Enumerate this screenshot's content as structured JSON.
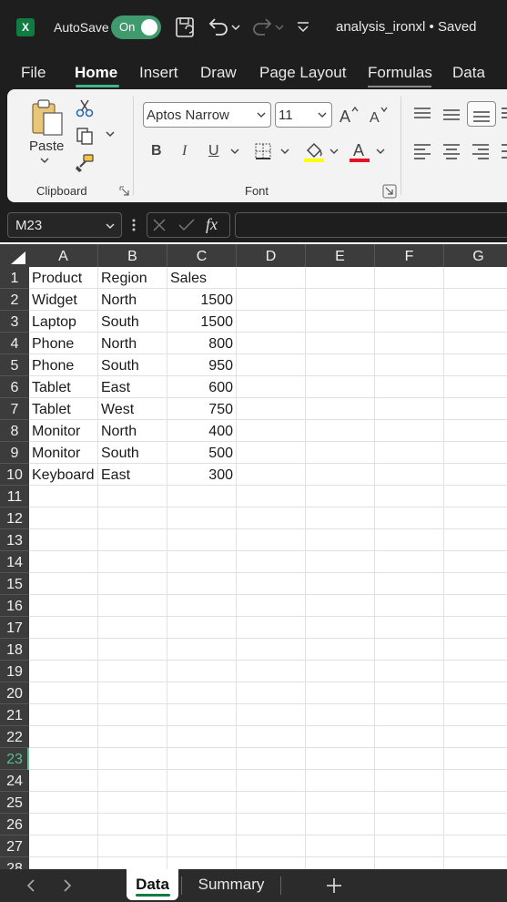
{
  "titlebar": {
    "app_logo_text": "X",
    "autosave_label": "AutoSave",
    "autosave_state": "On",
    "doc_title": "analysis_ironxl • Saved"
  },
  "menu": {
    "tabs": [
      "File",
      "Home",
      "Insert",
      "Draw",
      "Page Layout",
      "Formulas",
      "Data"
    ],
    "active": "Home"
  },
  "ribbon": {
    "clipboard": {
      "paste_label": "Paste",
      "group_label": "Clipboard"
    },
    "font": {
      "font_name": "Aptos Narrow",
      "font_size": "11",
      "bold": "B",
      "italic": "I",
      "underline": "U",
      "group_label": "Font",
      "highlight_color": "#ffff00",
      "font_color": "#e81123"
    }
  },
  "formula_bar": {
    "name_box": "M23",
    "fx_label": "fx",
    "formula": ""
  },
  "grid": {
    "columns": [
      "A",
      "B",
      "C",
      "D",
      "E",
      "F",
      "G"
    ],
    "rows": [
      "1",
      "2",
      "3",
      "4",
      "5",
      "6",
      "7",
      "8",
      "9",
      "10",
      "11",
      "12",
      "13",
      "14",
      "15",
      "16",
      "17",
      "18",
      "19",
      "20",
      "21",
      "22",
      "23",
      "24",
      "25",
      "26",
      "27",
      "28"
    ],
    "active_row": "23",
    "data": [
      [
        "Product",
        "Region",
        "Sales"
      ],
      [
        "Widget",
        "North",
        "1500"
      ],
      [
        "Laptop",
        "South",
        "1500"
      ],
      [
        "Phone",
        "North",
        "800"
      ],
      [
        "Phone",
        "South",
        "950"
      ],
      [
        "Tablet",
        "East",
        "600"
      ],
      [
        "Tablet",
        "West",
        "750"
      ],
      [
        "Monitor",
        "North",
        "400"
      ],
      [
        "Monitor",
        "South",
        "500"
      ],
      [
        "Keyboard",
        "East",
        "300"
      ]
    ]
  },
  "sheets": {
    "tabs": [
      "Data",
      "Summary"
    ],
    "active": "Data"
  },
  "colors": {
    "accent": "#107c41",
    "toggle_on": "#3f9a6e",
    "header_bg": "#3c3c3c",
    "chrome_bg": "#1e1e1e"
  }
}
